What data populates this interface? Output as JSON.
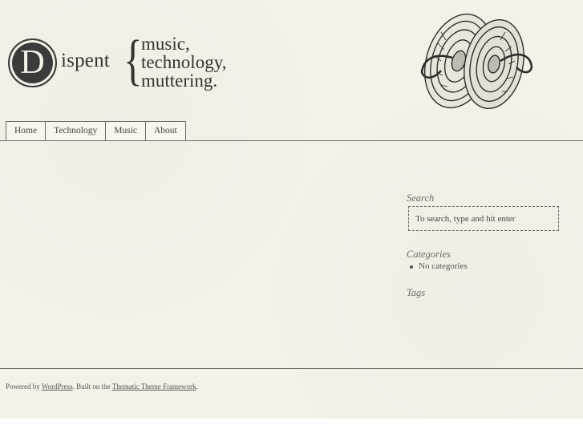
{
  "site": {
    "logo_letter": "D",
    "logo_word": "ispent",
    "brace": "{",
    "tagline": [
      "music,",
      "technology,",
      "muttering."
    ]
  },
  "header_image": {
    "icon": "cymbals-illustration"
  },
  "nav": {
    "items": [
      {
        "label": "Home"
      },
      {
        "label": "Technology"
      },
      {
        "label": "Music"
      },
      {
        "label": "About"
      }
    ]
  },
  "sidebar": {
    "search": {
      "title": "Search",
      "placeholder": "To search, type and hit enter"
    },
    "categories": {
      "title": "Categories",
      "items": [
        "No categories"
      ]
    },
    "tags": {
      "title": "Tags"
    }
  },
  "footer": {
    "powered_by": "Powered by ",
    "wordpress_link": "WordPress",
    "built_on": ". Built on the ",
    "framework_link": "Thematic Theme Framework",
    "end": "."
  },
  "colors": {
    "background": "#f4f2e7",
    "ink": "#3b3b39",
    "rule": "#6a6a66"
  }
}
